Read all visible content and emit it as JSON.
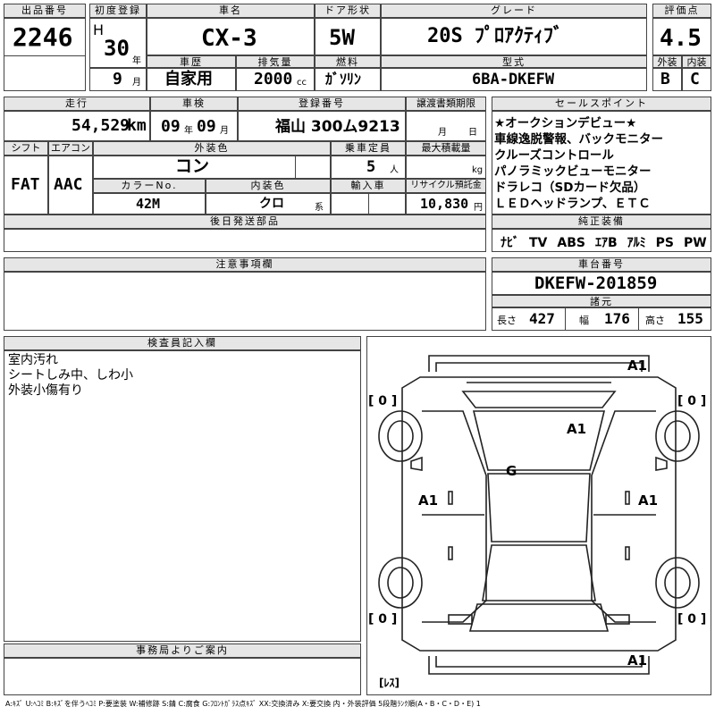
{
  "headers": {
    "lot_no": "出品番号",
    "first_reg": "初度登録",
    "car_name": "車名",
    "door": "ドア形状",
    "grade": "グレード",
    "score": "評価点",
    "exterior": "外装",
    "interior": "内装",
    "history": "車歴",
    "displacement": "排気量",
    "fuel": "燃料",
    "model_code": "型式",
    "mileage": "走行",
    "inspection": "車検",
    "reg_no": "登録番号",
    "transfer": "譲渡書類期限",
    "shift": "シフト",
    "aircon": "エアコン",
    "color": "外装色",
    "capacity": "乗車定員",
    "max_load": "最大積載量",
    "color_no": "カラーNo.",
    "int_color": "内装色",
    "import": "輸入車",
    "recycle": "リサイクル預託金",
    "later_parts": "後日発送部品",
    "sales_points": "セールスポイント",
    "equipment": "純正装備",
    "notes": "注意事項欄",
    "chassis": "車台番号",
    "origin": "諸元",
    "inspector": "検査員記入欄",
    "office": "事務局よりご案内"
  },
  "values": {
    "lot_no": "2246",
    "era_letter": "H",
    "year": "30",
    "year_unit": "年",
    "month": "9",
    "month_unit": "月",
    "car_name": "CX-3",
    "door": "5W",
    "grade": "20S ﾌﾟﾛｱｸﾃｨﾌﾞ",
    "score": "4.5",
    "exterior": "B",
    "interior": "C",
    "history": "自家用",
    "displacement": "2000",
    "disp_unit": "cc",
    "fuel": "ｶﾞｿﾘﾝ",
    "model_code": "6BA-DKEFW",
    "mileage": "54,529",
    "mileage_unit": "km",
    "insp_year": "09",
    "insp_year_unit": "年",
    "insp_month": "09",
    "insp_month_unit": "月",
    "reg_no": "福山 300ム9213",
    "transfer_month": "月",
    "transfer_day": "日",
    "shift": "FAT",
    "aircon": "AAC",
    "color": "コン",
    "capacity": "5",
    "capacity_unit": "人",
    "max_load_unit": "kg",
    "color_no": "42M",
    "int_color": "クロ",
    "int_color_unit": "系",
    "recycle": "10,830",
    "recycle_unit": "円",
    "chassis": "DKEFW-201859",
    "length_label": "長さ",
    "length": "427",
    "width_label": "幅",
    "width": "176",
    "height_label": "高さ",
    "height": "155"
  },
  "sales_points": [
    "★オークションデビュー★",
    "車線逸脱警報、バックモニター",
    "クルーズコントロール",
    "パノラミックビューモニター",
    "ドラレコ（SDカード欠品）",
    "ＬＥＤヘッドランプ、ＥＴＣ"
  ],
  "equipment": [
    "ﾅﾋﾞ",
    "TV",
    "ABS",
    "ｴｱB",
    "ｱﾙﾐ",
    "PS",
    "PW"
  ],
  "inspector_notes": [
    "室内汚れ",
    "シートしみ中、しわ小",
    "外装小傷有り"
  ],
  "diagram": {
    "front": "A1",
    "hood": "A1",
    "roof": "G",
    "left": "A1",
    "right": "A1",
    "rear": "A1",
    "tire_fl": "[ 0 ]",
    "tire_fr": "[ 0 ]",
    "tire_rl": "[ 0 ]",
    "tire_rr": "[ 0 ]",
    "spare": "[ﾚｽ]"
  },
  "legend": "A:ｷｽﾞ U:ﾍｺﾐ B:ｷｽﾞを伴うﾍｺﾐ P:要塗装 W:補修跡 S:錆 C:腐食 G:ﾌﾛﾝﾄｶﾞﾗｽ点ｷｽﾞ XX:交換済み X:要交換 内・外装評価 5段階ﾗﾝｸ順(A・B・C・D・E) 1"
}
